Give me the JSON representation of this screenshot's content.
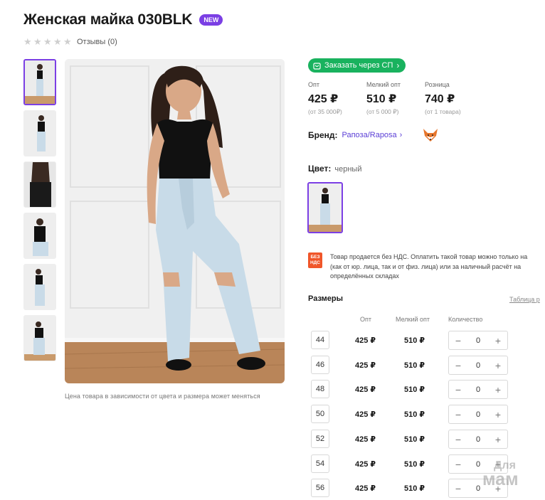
{
  "product": {
    "title": "Женская майка 030BLK",
    "badge": "NEW",
    "reviews": "Отзывы (0)",
    "stars": 0
  },
  "gallery": {
    "note": "Цена товара в зависимости от цвета и размера может меняться",
    "thumb_count": 6
  },
  "order_button": {
    "label": "Заказать через СП",
    "icon": "bag-icon"
  },
  "prices": [
    {
      "label": "Опт",
      "value": "425 ₽",
      "sub": "(от 35 000₽)"
    },
    {
      "label": "Мелкий опт",
      "value": "510 ₽",
      "sub": "(от 5 000 ₽)"
    },
    {
      "label": "Розница",
      "value": "740 ₽",
      "sub": "(от 1 товара)"
    }
  ],
  "brand": {
    "label": "Бренд:",
    "name": "Рапоза/Raposa",
    "logo": "fox-logo"
  },
  "color": {
    "label": "Цвет:",
    "value": "черный"
  },
  "vat": {
    "icon_text": "БЕЗ НДС",
    "line1": "Товар продается без НДС. Оплатить такой товар можно только на",
    "line2": "(как от юр. лица, так и от физ. лица) или за наличный расчёт на",
    "line3": "определённых складах"
  },
  "sizes": {
    "title": "Размеры",
    "table_link": "Таблица р",
    "columns": {
      "opt": "Опт",
      "small_opt": "Мелкий опт",
      "quantity": "Количество"
    },
    "rows": [
      {
        "size": "44",
        "opt": "425 ₽",
        "small_opt": "510 ₽",
        "qty": "0"
      },
      {
        "size": "46",
        "opt": "425 ₽",
        "small_opt": "510 ₽",
        "qty": "0"
      },
      {
        "size": "48",
        "opt": "425 ₽",
        "small_opt": "510 ₽",
        "qty": "0"
      },
      {
        "size": "50",
        "opt": "425 ₽",
        "small_opt": "510 ₽",
        "qty": "0"
      },
      {
        "size": "52",
        "opt": "425 ₽",
        "small_opt": "510 ₽",
        "qty": "0"
      },
      {
        "size": "54",
        "opt": "425 ₽",
        "small_opt": "510 ₽",
        "qty": "0"
      },
      {
        "size": "56",
        "opt": "425 ₽",
        "small_opt": "510 ₽",
        "qty": "0"
      }
    ],
    "minus": "−",
    "plus": "+"
  },
  "watermark": {
    "line1": "Для",
    "line2": "мам"
  },
  "colors": {
    "accent": "#7b3fe4",
    "green": "#19b25e",
    "vat": "#f0562a",
    "link": "#5b3fd6"
  }
}
